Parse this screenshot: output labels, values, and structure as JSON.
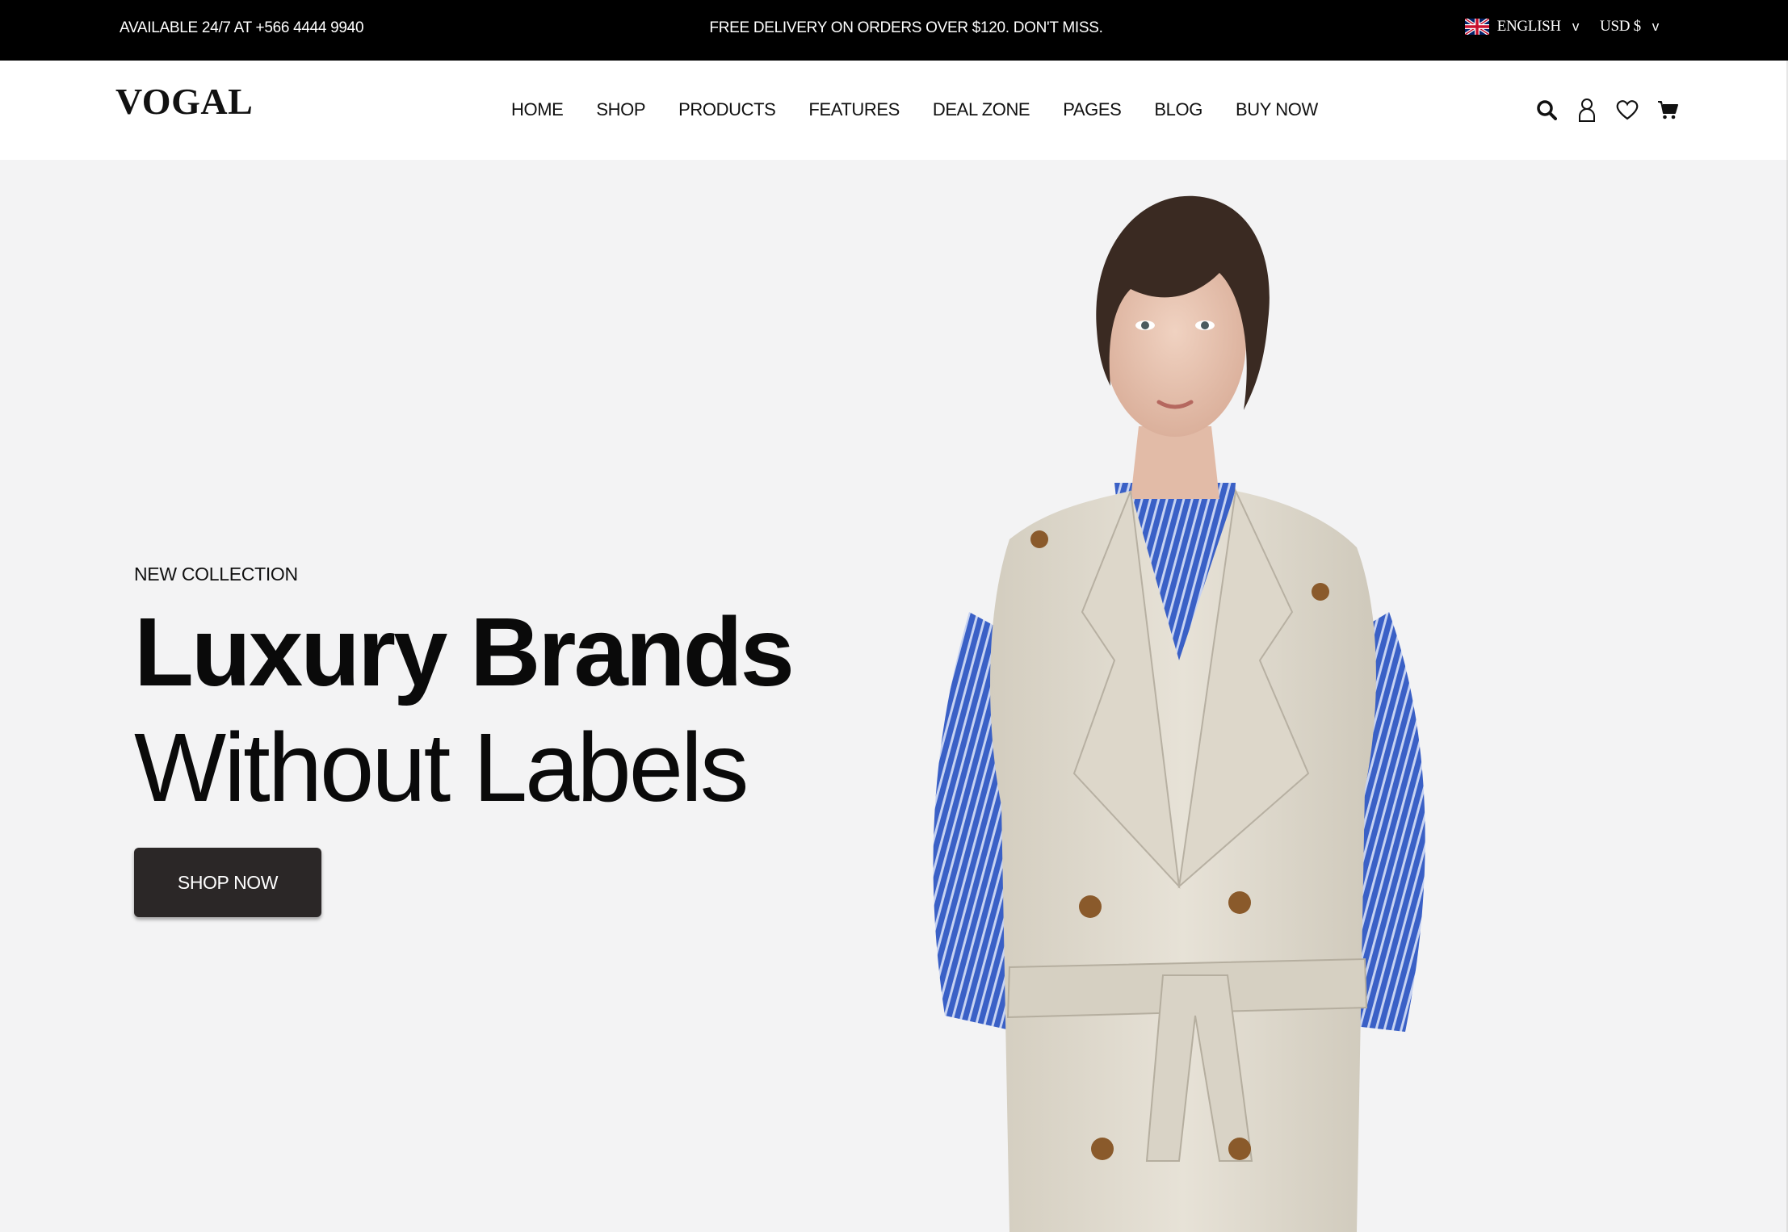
{
  "topbar": {
    "contact": "AVAILABLE 24/7 AT +566 4444 9940",
    "promo": "FREE DELIVERY ON ORDERS OVER $120. DON'T MISS.",
    "language": "ENGLISH",
    "currency": "USD $",
    "chevron": "v"
  },
  "header": {
    "logo": "VOGAL",
    "nav": [
      "HOME",
      "SHOP",
      "PRODUCTS",
      "FEATURES",
      "DEAL ZONE",
      "PAGES",
      "BLOG",
      "BUY NOW"
    ],
    "icons": [
      "search-icon",
      "user-icon",
      "heart-icon",
      "cart-icon"
    ]
  },
  "hero": {
    "eyebrow": "NEW COLLECTION",
    "headline_bold": "Luxury Brands",
    "headline_light": "Without Labels",
    "cta": "SHOP NOW"
  },
  "colors": {
    "topbar_bg": "#000000",
    "hero_bg": "#f3f3f4",
    "button_bg": "#2b2727",
    "coat": "#e2ddd1",
    "shirt": "#3b62c9"
  }
}
